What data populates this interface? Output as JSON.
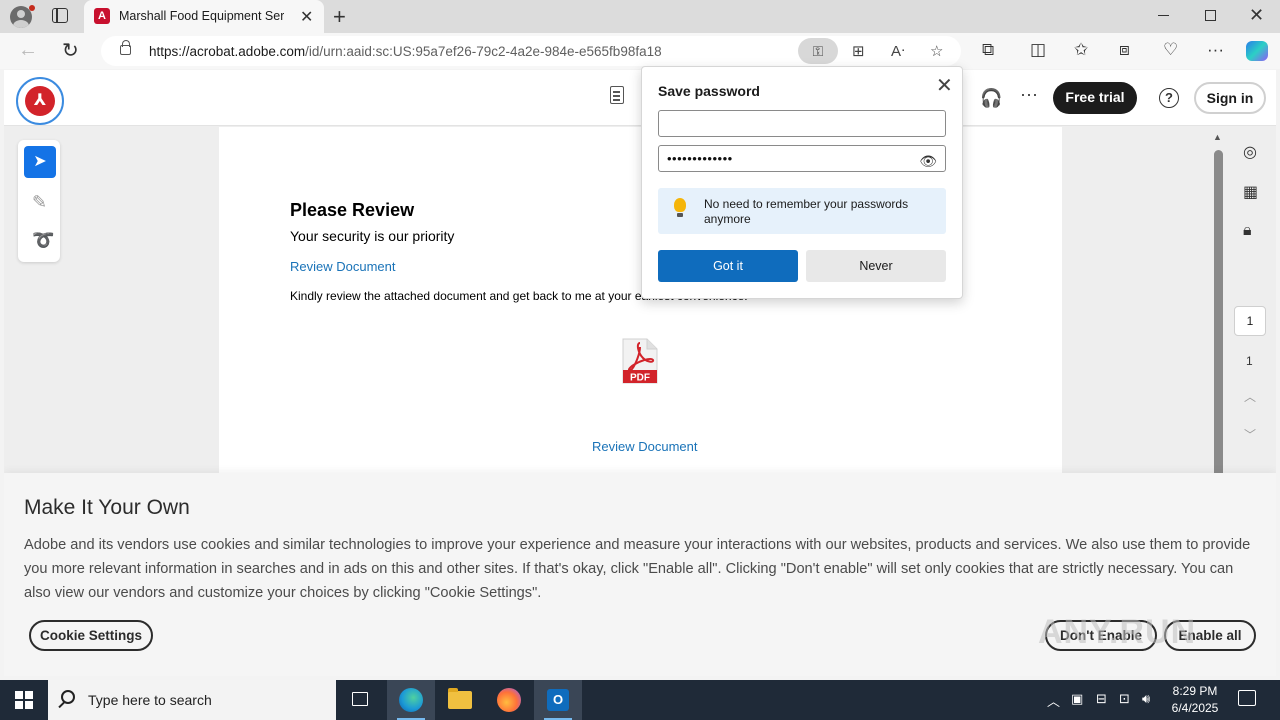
{
  "browser": {
    "tab_title": "Marshall Food Equipment Services",
    "tab_favicon": "A",
    "url_host": "https://acrobat.adobe.com",
    "url_path": "/id/urn:aaid:sc:US:95a7ef26-79c2-4a2e-984e-e565fb98fa18"
  },
  "header": {
    "free_trial": "Free trial",
    "help": "?",
    "sign_in": "Sign in",
    "more": "···"
  },
  "document": {
    "title": "Please Review",
    "subtitle": "Your security is our priority",
    "link_top": "Review Document",
    "body": "Kindly review the attached document and get back to me at your earliest convenience.",
    "pdf_label": "PDF",
    "link_bottom": "Review Document"
  },
  "page_nav": {
    "current": "1",
    "total": "1"
  },
  "password_popup": {
    "title": "Save password",
    "username_value": "",
    "password_masked": "•••••••••••••",
    "info_text": "No need to remember your passwords anymore",
    "got_it": "Got it",
    "never": "Never"
  },
  "cookie_banner": {
    "title": "Make It Your Own",
    "body": "Adobe and its vendors use cookies and similar technologies to improve your experience and measure your interactions with our websites, products and services. We also use them to provide you more relevant information in searches and in ads on this and other sites. If that's okay, click \"Enable all\". Clicking \"Don't enable\" will set only cookies that are strictly necessary. You can also view our vendors and customize your choices by clicking \"Cookie Settings\".",
    "settings_button": "Cookie Settings",
    "dont_enable_button": "Don't Enable",
    "enable_all_button": "Enable all",
    "watermark": "ANY.RUN"
  },
  "taskbar": {
    "search_placeholder": "Type here to search",
    "time": "8:29 PM",
    "date": "6/4/2025",
    "outlook_label": "O"
  },
  "colors": {
    "adobe_red": "#d2232a",
    "primary_blue": "#1473e6",
    "edge_button_blue": "#0f6cbd",
    "link_blue": "#1a73b8"
  }
}
